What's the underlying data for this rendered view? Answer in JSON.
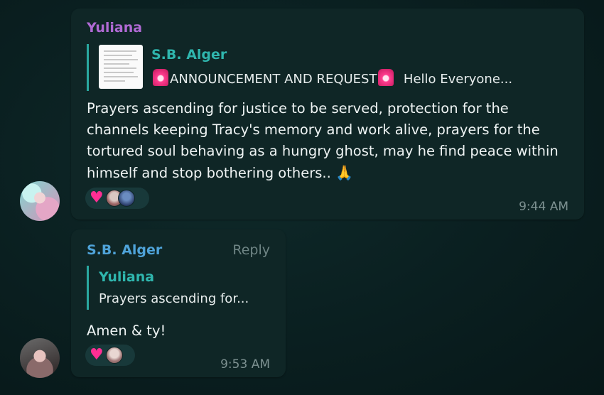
{
  "messages": [
    {
      "sender": "Yuliana",
      "quoted": {
        "author": "S.B. Alger",
        "snippet_a": "ANNOUNCEMENT AND  REQUEST",
        "snippet_b": "  Hello Everyone..."
      },
      "body": "Prayers ascending for justice to be served, protection for the channels keeping Tracy's memory and work alive, prayers for the tortured soul behaving as a hungry ghost, may he find peace within himself and stop bothering others.. ",
      "emoji": "🙏",
      "reaction": "♥",
      "time": "9:44 AM"
    },
    {
      "sender": "S.B. Alger",
      "reply_label": "Reply",
      "quoted": {
        "author": "Yuliana",
        "snippet": "Prayers ascending for..."
      },
      "body": "Amen & ty!",
      "reaction": "♥",
      "time": "9:53 AM"
    }
  ],
  "colors": {
    "background": "#0a1f20",
    "bubble": "#0f2626",
    "yuliana_name": "#b06ad4",
    "alger_name": "#4fa3d9",
    "quote_accent": "#2aa8a0",
    "heart": "#ff2e93"
  },
  "icons": [
    "siren-emoji-icon",
    "folded-hands-emoji-icon",
    "heart-icon",
    "reactor-avatar-icon",
    "user-avatar-icon"
  ]
}
